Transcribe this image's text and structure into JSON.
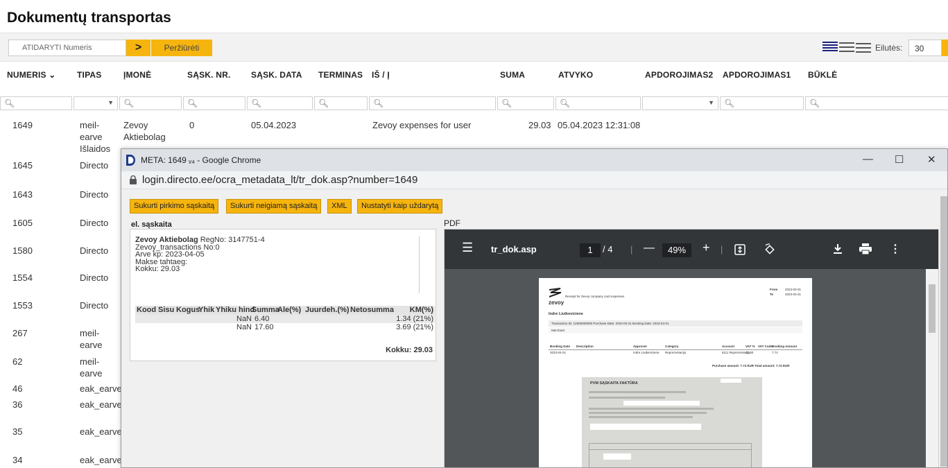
{
  "page_title": "Dokumentų transportas",
  "toolbar": {
    "number_placeholder": "ATIDARYTI Numeris",
    "go_label": ">",
    "view_label": "Peržiūrėti",
    "rows_label": "Eilutės:",
    "rows_value": "30"
  },
  "columns": [
    "NUMERIS",
    "TIPAS",
    "ĮMONĖ",
    "SĄSK. NR.",
    "SĄSK. DATA",
    "TERMINAS",
    "IŠ / Į",
    "SUMA",
    "ATVYKO",
    "APDOROJIMAS2",
    "APDOROJIMAS1",
    "BŪKLĖ"
  ],
  "rows": [
    {
      "numeris": "1649",
      "tipas": [
        "meil-",
        "earve",
        "Išlaidos"
      ],
      "imone": [
        "Zevoy",
        "Aktiebolag"
      ],
      "sask_nr": "0",
      "sask_data": "05.04.2023",
      "is_i": "Zevoy expenses for user",
      "suma": "29.03",
      "atvyko": "05.04.2023 12:31:08"
    },
    {
      "numeris": "1645",
      "tipas": [
        "Directo"
      ]
    },
    {
      "numeris": "1643",
      "tipas": [
        "Directo"
      ]
    },
    {
      "numeris": "1605",
      "tipas": [
        "Directo"
      ]
    },
    {
      "numeris": "1580",
      "tipas": [
        "Directo"
      ]
    },
    {
      "numeris": "1554",
      "tipas": [
        "Directo"
      ]
    },
    {
      "numeris": "1553",
      "tipas": [
        "Directo"
      ]
    },
    {
      "numeris": "267",
      "tipas": [
        "meil-",
        "earve"
      ]
    },
    {
      "numeris": "62",
      "tipas": [
        "meil-",
        "earve"
      ]
    },
    {
      "numeris": "46",
      "tipas": [
        "eak_earve"
      ]
    },
    {
      "numeris": "36",
      "tipas": [
        "eak_earve"
      ]
    },
    {
      "numeris": "35",
      "tipas": [
        "eak_earve"
      ]
    },
    {
      "numeris": "34",
      "tipas": [
        "eak_earve"
      ]
    }
  ],
  "popup": {
    "window_title": "META: 1649 ᵥ₄ - Google Chrome",
    "url": "login.directo.ee/ocra_metadata_lt/tr_dok.asp?number=1649",
    "buttons": [
      "Sukurti pirkimo sąskaitą",
      "Sukurti neigiamą sąskaitą",
      "XML",
      "Nustatyti kaip uždarytą"
    ],
    "einv_label": "el. sąskaita",
    "pdf_label": "PDF",
    "einv_lines": [
      "Zevoy Aktiebolag",
      "RegNo: 3147751-4",
      "Zevoy_transactions No:0",
      "Arve kp: 2023-04-05",
      "Makse tahtaeg:",
      "Kokku: 29.03"
    ],
    "items_header": [
      "Kood",
      "Sisu",
      "Kogus",
      "Yhik",
      "Yhiku hind",
      "Summa",
      "Ale(%)",
      "Juurdeh.(%)",
      "Netosumma",
      "KM(%)"
    ],
    "items": [
      {
        "summa": "NaN",
        "ale": "6.40",
        "km": "1.34 (21%)"
      },
      {
        "summa": "NaN",
        "ale": "17.60",
        "km": "3.69 (21%)"
      }
    ],
    "total": "Kokku: 29.03",
    "pdf": {
      "filename": "tr_dok.asp",
      "page": "1",
      "page_total": "/ 4",
      "zoom": "49%",
      "doc": {
        "brand": "zevoy",
        "receipt_text": "Receipt for Zevoy company card expenses",
        "from_label": "From",
        "from_value": "2023-03-01",
        "to_label": "To",
        "to_value": "2023-03-31",
        "person": "Indre Liutkeviciene",
        "transaction_line": "Transaction ID:  12000000000   Purchase Date:  2023-03-31   Booking Date:  2023-04-01",
        "merchant_label": "Merchant:",
        "table_header": [
          "Booking Date",
          "Description",
          "Approver",
          "Category",
          "Account",
          "VAT %",
          "VAT Code",
          "Booking Amount"
        ],
        "table_row": [
          "2023-04-01",
          "",
          "Indre Liutkeviciene",
          "Reprezentacija",
          "6111 Reprezentacija",
          "21.00",
          "",
          "7.74"
        ],
        "purchase_amount": "Purchase amount:  7.74 EUR    Total amount:  7.74 EUR",
        "invoice_title": "PVM SĄSKAITA FAKTŪRA"
      }
    }
  }
}
